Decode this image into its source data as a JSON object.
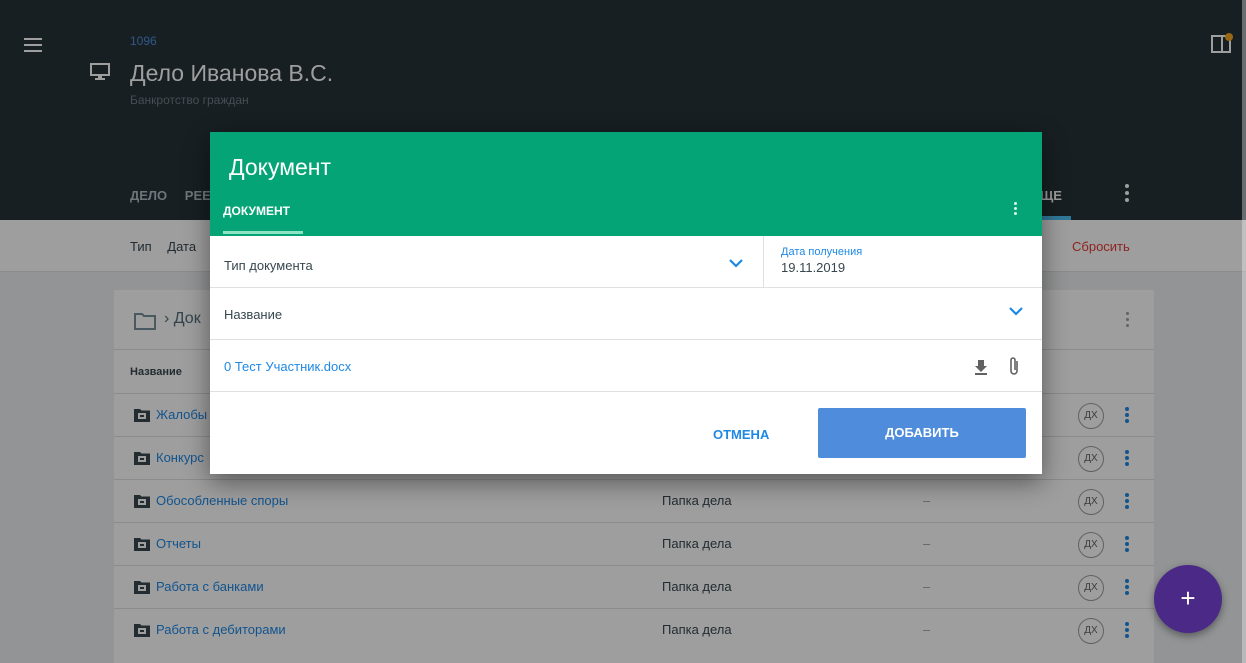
{
  "header": {
    "case_number": "1096",
    "case_title": "Дело Иванова В.С.",
    "case_subtitle": "Банкротство граждан",
    "tabs_left": [
      "ДЕЛО",
      "РЕЕ"
    ],
    "tab_right": "ЩЕ"
  },
  "filter_bar": {
    "labels": [
      "Тип",
      "Дата"
    ],
    "reset_label": "Сбросить"
  },
  "card": {
    "breadcrumb": "› Док",
    "column_header": "Название",
    "rows": [
      {
        "name": "Жалобы",
        "type": "",
        "dash": "",
        "badge": "ДХ"
      },
      {
        "name": "Конкурс",
        "type": "",
        "dash": "",
        "badge": "ДХ"
      },
      {
        "name": "Обособленные споры",
        "type": "Папка дела",
        "dash": "–",
        "badge": "ДХ"
      },
      {
        "name": "Отчеты",
        "type": "Папка дела",
        "dash": "–",
        "badge": "ДХ"
      },
      {
        "name": "Работа с банками",
        "type": "Папка дела",
        "dash": "–",
        "badge": "ДХ"
      },
      {
        "name": "Работа с дебиторами",
        "type": "Папка дела",
        "dash": "–",
        "badge": "ДХ"
      }
    ]
  },
  "dialog": {
    "title": "Документ",
    "tab": "ДОКУМЕНТ",
    "doc_type_label": "Тип документа",
    "date_label": "Дата получения",
    "date_value": "19.11.2019",
    "name_label": "Название",
    "file_name": "0 Тест Участник.docx",
    "cancel_label": "ОТМЕНА",
    "add_label": "ДОБАВИТЬ"
  },
  "fab": {
    "label": "+"
  },
  "colors": {
    "header_bg": "#263238",
    "dialog_accent": "#05a476",
    "primary": "#4f8ddc",
    "fab": "#4a2a86",
    "reset": "#e53935"
  }
}
